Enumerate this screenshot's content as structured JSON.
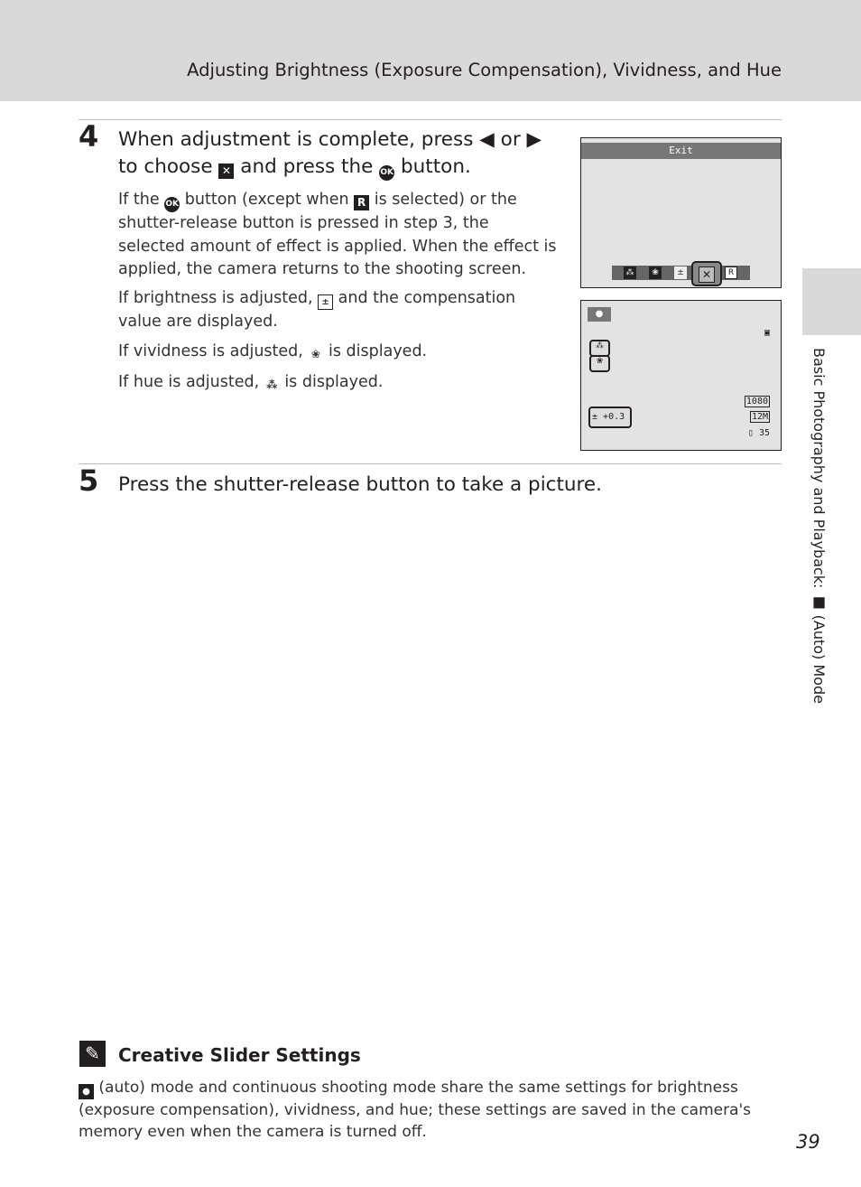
{
  "header": {
    "title": "Adjusting Brightness (Exposure Compensation), Vividness, and Hue"
  },
  "step4": {
    "number": "4",
    "heading_a": "When adjustment is complete, press",
    "heading_or": "or",
    "heading_b": "to choose",
    "heading_c": "and press the",
    "heading_d": "button.",
    "p1_a": "If the",
    "p1_b": "button (except when",
    "p1_c": "is selected) or the shutter-release button is pressed in step 3, the selected amount of effect is applied. When the effect is applied, the camera returns to the shooting screen.",
    "p2_a": "If brightness is adjusted,",
    "p2_b": "and the compensation value are displayed.",
    "p3_a": "If vividness is adjusted,",
    "p3_b": "is displayed.",
    "p4_a": "If hue is adjusted,",
    "p4_b": "is displayed."
  },
  "screen1": {
    "exit_label": "Exit",
    "slider_items": [
      "hue",
      "vividness",
      "brightness",
      "exit",
      "reset"
    ],
    "selected": "exit",
    "reset_label": "R"
  },
  "screen2": {
    "exposure_value": "+0.3",
    "movie_mode": "1080",
    "image_size": "12M",
    "remaining_shots": "35"
  },
  "step5": {
    "number": "5",
    "heading": "Press the shutter-release button to take a picture."
  },
  "side_tab": {
    "text_a": "Basic Photography and Playback:",
    "text_b": "(Auto) Mode"
  },
  "note": {
    "title": "Creative Slider Settings",
    "body": "(auto) mode and continuous shooting mode share the same settings for brightness (exposure compensation), vividness, and hue; these settings are saved in the camera's memory even when the camera is turned off."
  },
  "page_number": "39"
}
